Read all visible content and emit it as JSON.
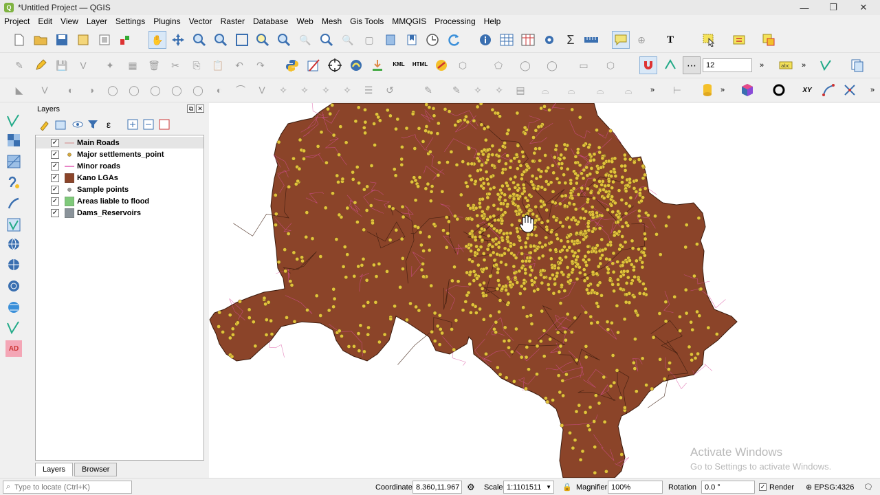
{
  "window": {
    "title": "*Untitled Project — QGIS",
    "app_icon": "Q"
  },
  "menu": [
    "Project",
    "Edit",
    "View",
    "Layer",
    "Settings",
    "Plugins",
    "Vector",
    "Raster",
    "Database",
    "Web",
    "Mesh",
    "Gis Tools",
    "MMQGIS",
    "Processing",
    "Help"
  ],
  "snapping": {
    "tolerance": "12"
  },
  "layers_panel": {
    "title": "Layers",
    "items": [
      {
        "name": "Main Roads",
        "checked": true,
        "symbol": "line",
        "color": "#d9a6a6",
        "selected": true
      },
      {
        "name": "Major settlements_point",
        "checked": true,
        "symbol": "point",
        "color": "#d4a93a"
      },
      {
        "name": "Minor roads",
        "checked": true,
        "symbol": "line",
        "color": "#e05ab2"
      },
      {
        "name": "Kano LGAs",
        "checked": true,
        "symbol": "fill",
        "color": "#8b4429"
      },
      {
        "name": "Sample points",
        "checked": true,
        "symbol": "point",
        "color": "#9a9a9a"
      },
      {
        "name": "Areas liable to flood",
        "checked": true,
        "symbol": "fill",
        "color": "#7fc97a"
      },
      {
        "name": "Dams_Reservoirs",
        "checked": true,
        "symbol": "fill",
        "color": "#8a939a"
      }
    ],
    "tabs": [
      "Layers",
      "Browser"
    ]
  },
  "side_tools": {
    "ad_label": "AD"
  },
  "watermark": {
    "line1": "Activate Windows",
    "line2": "Go to Settings to activate Windows."
  },
  "status": {
    "locator_placeholder": "Type to locate (Ctrl+K)",
    "coordinate_label": "Coordinate",
    "coordinate_value": "8.360,11.967",
    "scale_label": "Scale",
    "scale_value": "1:1101511",
    "magnifier_label": "Magnifier",
    "magnifier_value": "100%",
    "rotation_label": "Rotation",
    "rotation_value": "0.0 °",
    "render_label": "Render",
    "crs_label": "EPSG:4326"
  },
  "colors": {
    "lga_fill": "#8b4429",
    "lga_border": "#3a1a0c",
    "settlement": "#e3c23a",
    "road_minor": "#d8509e",
    "road_main": "#e06060"
  }
}
